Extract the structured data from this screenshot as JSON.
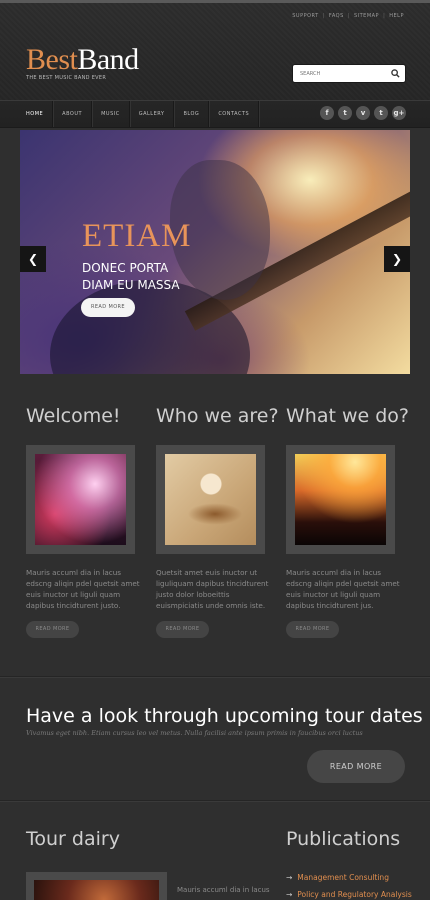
{
  "header": {
    "utility_links": [
      "SUPPORT",
      "FAQS",
      "SITEMAP",
      "HELP"
    ],
    "logo_best": "Best",
    "logo_band": "Band",
    "tagline": "THE BEST MUSIC BAND EVER",
    "search_placeholder": "SEARCH"
  },
  "nav": {
    "items": [
      "HOME",
      "ABOUT",
      "MUSIC",
      "GALLERY",
      "BLOG",
      "CONTACTS"
    ],
    "active": "HOME",
    "social": [
      "f",
      "t",
      "v",
      "t",
      "g+"
    ]
  },
  "slider": {
    "title": "ETIAM",
    "subtitle_line1": "DONEC PORTA",
    "subtitle_line2": "DIAM EU MASSA",
    "button": "READ MORE"
  },
  "columns": [
    {
      "heading": "Welcome!",
      "text": "Mauris accuml dia in lacus edscng aliqin pdel quetsit amet euis inuctor ut liguli quam dapibus tincidturent justo.",
      "button": "READ MORE"
    },
    {
      "heading": "Who we are?",
      "text": "Quetsit amet euis inuctor ut liguliquam dapibus tincidturent justo dolor loboeittis euismpiciatis unde omnis iste.",
      "button": "READ MORE"
    },
    {
      "heading": "What we do?",
      "text": "Mauris accuml dia in lacus edscng aliqin pdel quetsit amet euis inuctor ut liguli quam dapibus tincidturent jus.",
      "button": "READ MORE"
    }
  ],
  "tour": {
    "heading": "Have a look through upcoming tour dates",
    "subtext": "Vivamus eget nibh. Etiam cursus leo vel metus. Nulla facilisi ante ipsum primis in faucibus orci luctus",
    "button": "READ MORE"
  },
  "tour_dairy": {
    "heading": "Tour dairy",
    "text": "Mauris accuml dia in lacus"
  },
  "publications": {
    "heading": "Publications",
    "items": [
      "Management Consulting",
      "Policy and Regulatory Analysis"
    ]
  },
  "colors": {
    "accent": "#e08e4f",
    "background": "#2f2f2f"
  }
}
